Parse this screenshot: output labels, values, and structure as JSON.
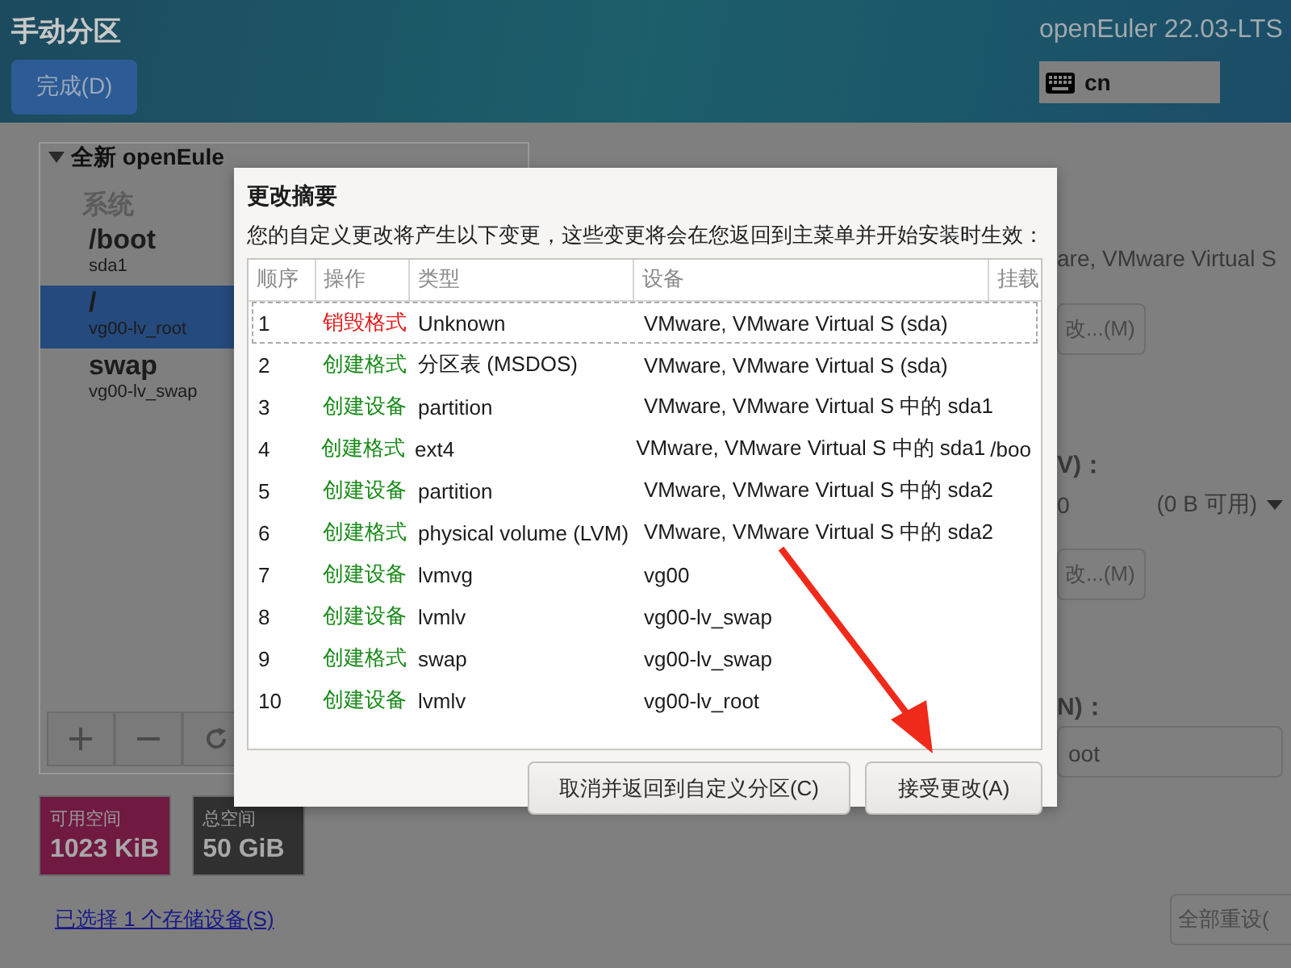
{
  "header": {
    "title": "手动分区",
    "done_button": "完成(D)",
    "product": "openEuler 22.03-LTS",
    "keyboard": "cn"
  },
  "tree": {
    "group": "全新 openEule",
    "section": "系统",
    "items": [
      {
        "mount": "/boot",
        "device": "sda1",
        "selected": false
      },
      {
        "mount": "/",
        "device": "vg00-lv_root",
        "selected": true
      },
      {
        "mount": "swap",
        "device": "vg00-lv_swap",
        "selected": false
      }
    ]
  },
  "space": [
    {
      "label": "可用空间",
      "value": "1023 KiB",
      "color": "#701a42"
    },
    {
      "label": "总空间",
      "value": "50 GiB",
      "color": "#303030"
    }
  ],
  "storage_link": "已选择 1 个存储设备(S)",
  "details": {
    "device_fragment": "are, VMware Virtual S",
    "modify_button_1": "改...(M)",
    "volume_label_fragment": "V)：",
    "volume_value_fragment": "0",
    "volume_free": "(0 B 可用)",
    "modify_button_2": "改...(M)",
    "name_label_fragment": "N)：",
    "name_value_fragment": "oot",
    "reset_button": "全部重设("
  },
  "dialog": {
    "title": "更改摘要",
    "message": "您的自定义更改将产生以下变更，这些变更将会在您返回到主菜单并开始安装时生效：",
    "columns": [
      "顺序",
      "操作",
      "类型",
      "设备",
      "挂载"
    ],
    "rows": [
      {
        "order": "1",
        "action": "销毁格式",
        "kind": "destroy",
        "type": "Unknown",
        "device": "VMware, VMware Virtual S (sda)",
        "focused": true
      },
      {
        "order": "2",
        "action": "创建格式",
        "kind": "create",
        "type": "分区表 (MSDOS)",
        "device": "VMware, VMware Virtual S (sda)",
        "focused": false
      },
      {
        "order": "3",
        "action": "创建设备",
        "kind": "create",
        "type": "partition",
        "device": "VMware, VMware Virtual S 中的 sda1",
        "focused": false
      },
      {
        "order": "4",
        "action": "创建格式",
        "kind": "create",
        "type": "ext4",
        "device": "VMware, VMware Virtual S 中的 sda1",
        "mount": "/boo",
        "focused": false
      },
      {
        "order": "5",
        "action": "创建设备",
        "kind": "create",
        "type": "partition",
        "device": "VMware, VMware Virtual S 中的 sda2",
        "focused": false
      },
      {
        "order": "6",
        "action": "创建格式",
        "kind": "create",
        "type": "physical volume (LVM)",
        "device": "VMware, VMware Virtual S 中的 sda2",
        "focused": false
      },
      {
        "order": "7",
        "action": "创建设备",
        "kind": "create",
        "type": "lvmvg",
        "device": "vg00",
        "focused": false
      },
      {
        "order": "8",
        "action": "创建设备",
        "kind": "create",
        "type": "lvmlv",
        "device": "vg00-lv_swap",
        "focused": false
      },
      {
        "order": "9",
        "action": "创建格式",
        "kind": "create",
        "type": "swap",
        "device": "vg00-lv_swap",
        "focused": false
      },
      {
        "order": "10",
        "action": "创建设备",
        "kind": "create",
        "type": "lvmlv",
        "device": "vg00-lv_root",
        "focused": false
      }
    ],
    "cancel_button": "取消并返回到自定义分区(C)",
    "accept_button": "接受更改(A)"
  }
}
